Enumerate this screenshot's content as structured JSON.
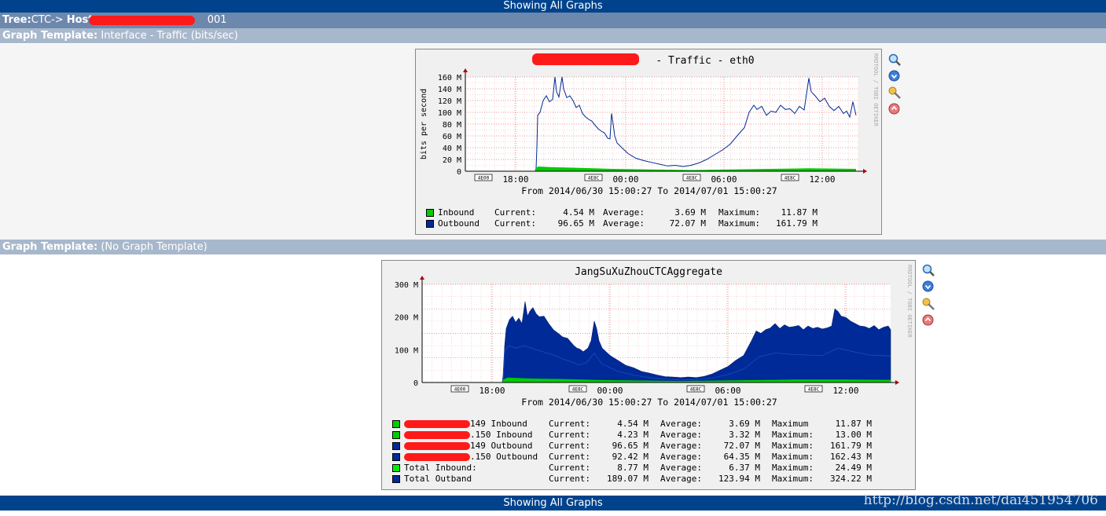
{
  "header": {
    "title": "Showing All Graphs"
  },
  "tree": {
    "tree_label": "Tree:",
    "tree_value": "CTC-> ",
    "host_label": "Host:",
    "host_value_visible": "001"
  },
  "templates": [
    {
      "label": "Graph Template:",
      "value": "Interface - Traffic (bits/sec)"
    },
    {
      "label": "Graph Template:",
      "value": "(No Graph Template)"
    }
  ],
  "graph1": {
    "title_visible": " - Traffic - eth0",
    "side_text": "RRDTOOL / TOBI OETIKER",
    "ylabel": "bits per second",
    "yticks": [
      "160 M",
      "140 M",
      "120 M",
      "100 M",
      "80 M",
      "60 M",
      "40 M",
      "20 M",
      "0"
    ],
    "xticks": [
      "18:00",
      "00:00",
      "06:00",
      "12:00"
    ],
    "week_tags": [
      "4E00",
      "4E8C",
      "4E8C",
      "4E8C"
    ],
    "period": "From 2014/06/30 15:00:27 To 2014/07/01 15:00:27",
    "legend": [
      {
        "name": "Inbound",
        "color": "#00cc00",
        "current": "4.54 M",
        "average": "3.69 M",
        "maximum": "11.87 M"
      },
      {
        "name": "Outbound",
        "color": "#002a97",
        "current": "96.65 M",
        "average": "72.07 M",
        "maximum": "161.79 M"
      }
    ],
    "labels": {
      "current": "Current:",
      "average": "Average:",
      "maximum": "Maximum:"
    }
  },
  "graph2": {
    "title": "JangSuXuZhouCTCAggregate",
    "side_text": "RRDTOOL / TOBI OETIKER",
    "yticks": [
      "300 M",
      "200 M",
      "100 M",
      "0"
    ],
    "xticks": [
      "18:00",
      "00:00",
      "06:00",
      "12:00"
    ],
    "week_tags": [
      "4E00",
      "4E8C",
      "4E8C",
      "4E8C"
    ],
    "period": "From 2014/06/30 15:00:27 To 2014/07/01 15:00:27",
    "legend": [
      {
        "name": "149 Inbound",
        "color": "#00cc00",
        "current": "4.54 M",
        "average": "3.69 M",
        "max_label": "Maximum",
        "maximum": "11.87 M"
      },
      {
        "name": ".150 Inbound",
        "color": "#00cc00",
        "current": "4.23 M",
        "average": "3.32 M",
        "max_label": "Maximum:",
        "maximum": "13.00 M"
      },
      {
        "name": "149 Outbound",
        "color": "#002a97",
        "current": "96.65 M",
        "average": "72.07 M",
        "max_label": "Maximum:",
        "maximum": "161.79 M"
      },
      {
        "name": ".150 Outbound",
        "color": "#002a97",
        "current": "92.42 M",
        "average": "64.35 M",
        "max_label": "Maximum:",
        "maximum": "162.43 M"
      },
      {
        "name": "Total Inbound:",
        "color": "#00ee00",
        "current": "8.77 M",
        "average": "6.37 M",
        "max_label": "Maximum:",
        "maximum": "24.49 M"
      },
      {
        "name": "Total Outband",
        "color": "#002a97",
        "current": "189.07 M",
        "average": "123.94 M",
        "max_label": "Maximum:",
        "maximum": "324.22 M"
      }
    ],
    "labels": {
      "current": "Current:",
      "average": "Average:"
    }
  },
  "icons": [
    "zoom-icon",
    "download-icon",
    "properties-icon",
    "top-icon"
  ],
  "watermark": "http://blog.csdn.net/dai451954706",
  "footer": {
    "title": "Showing All Graphs"
  }
}
